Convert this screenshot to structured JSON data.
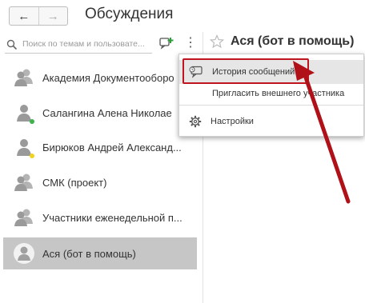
{
  "header": {
    "title": "Обсуждения",
    "back_icon": "arrow-left-icon",
    "forward_icon": "arrow-right-icon"
  },
  "search": {
    "placeholder": "Поиск по темам и пользовате..."
  },
  "conversations": [
    {
      "label": "Академия Документооборо",
      "icon": "group-icon",
      "status": null
    },
    {
      "label": "Салангина Алена Николае",
      "icon": "user-icon",
      "status": "#3cb44b"
    },
    {
      "label": "Бирюков Андрей Александ...",
      "icon": "user-icon",
      "status": "#f2d21a"
    },
    {
      "label": "СМК (проект)",
      "icon": "group-icon",
      "status": null
    },
    {
      "label": "Участники еженедельной п...",
      "icon": "group-icon",
      "status": null
    },
    {
      "label": "Ася (бот в помощь)",
      "icon": "user-icon",
      "status": null,
      "selected": true
    }
  ],
  "chat": {
    "title": "Ася (бот в помощь)",
    "star_icon": "star-icon"
  },
  "menu": {
    "history_label": "История сообщений",
    "invite_label": "Пригласить внешнего участника",
    "settings_label": "Настройки"
  },
  "colors": {
    "annotation": "#c0141e",
    "selected_bg": "#c6c6c6",
    "online": "#3cb44b",
    "away": "#f2d21a"
  }
}
